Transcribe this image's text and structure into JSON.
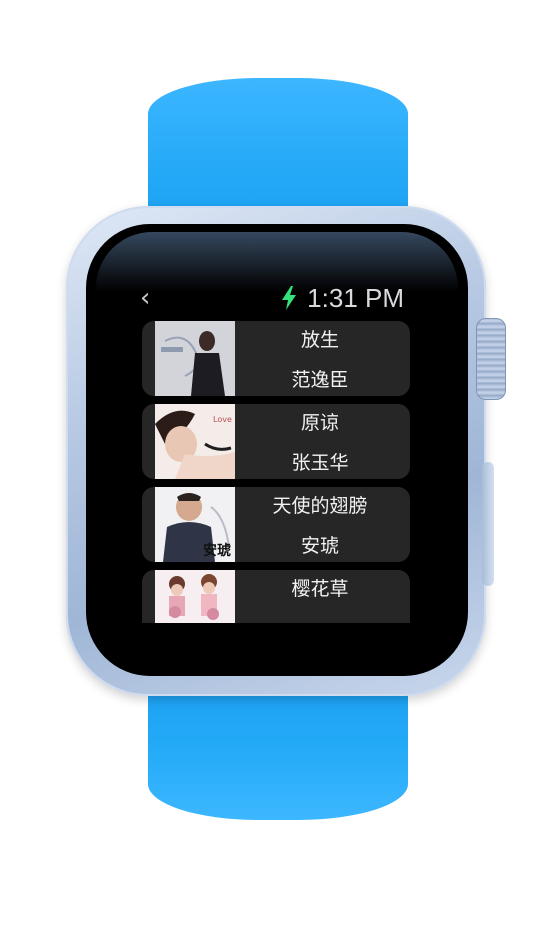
{
  "status": {
    "time": "1:31 PM",
    "charging_icon": "bolt-icon",
    "charging_color": "#34e07a"
  },
  "nav": {
    "back_icon": "chevron-left-icon",
    "back_glyph": "‹"
  },
  "songs": [
    {
      "title": "放生",
      "artist": "范逸臣"
    },
    {
      "title": "原谅",
      "artist": "张玉华"
    },
    {
      "title": "天使的翅膀",
      "artist": "安琥",
      "art_text": "安琥"
    },
    {
      "title": "樱花草",
      "artist": ""
    }
  ],
  "colors": {
    "band": "#22a8f6",
    "row_bg": "#262627"
  }
}
